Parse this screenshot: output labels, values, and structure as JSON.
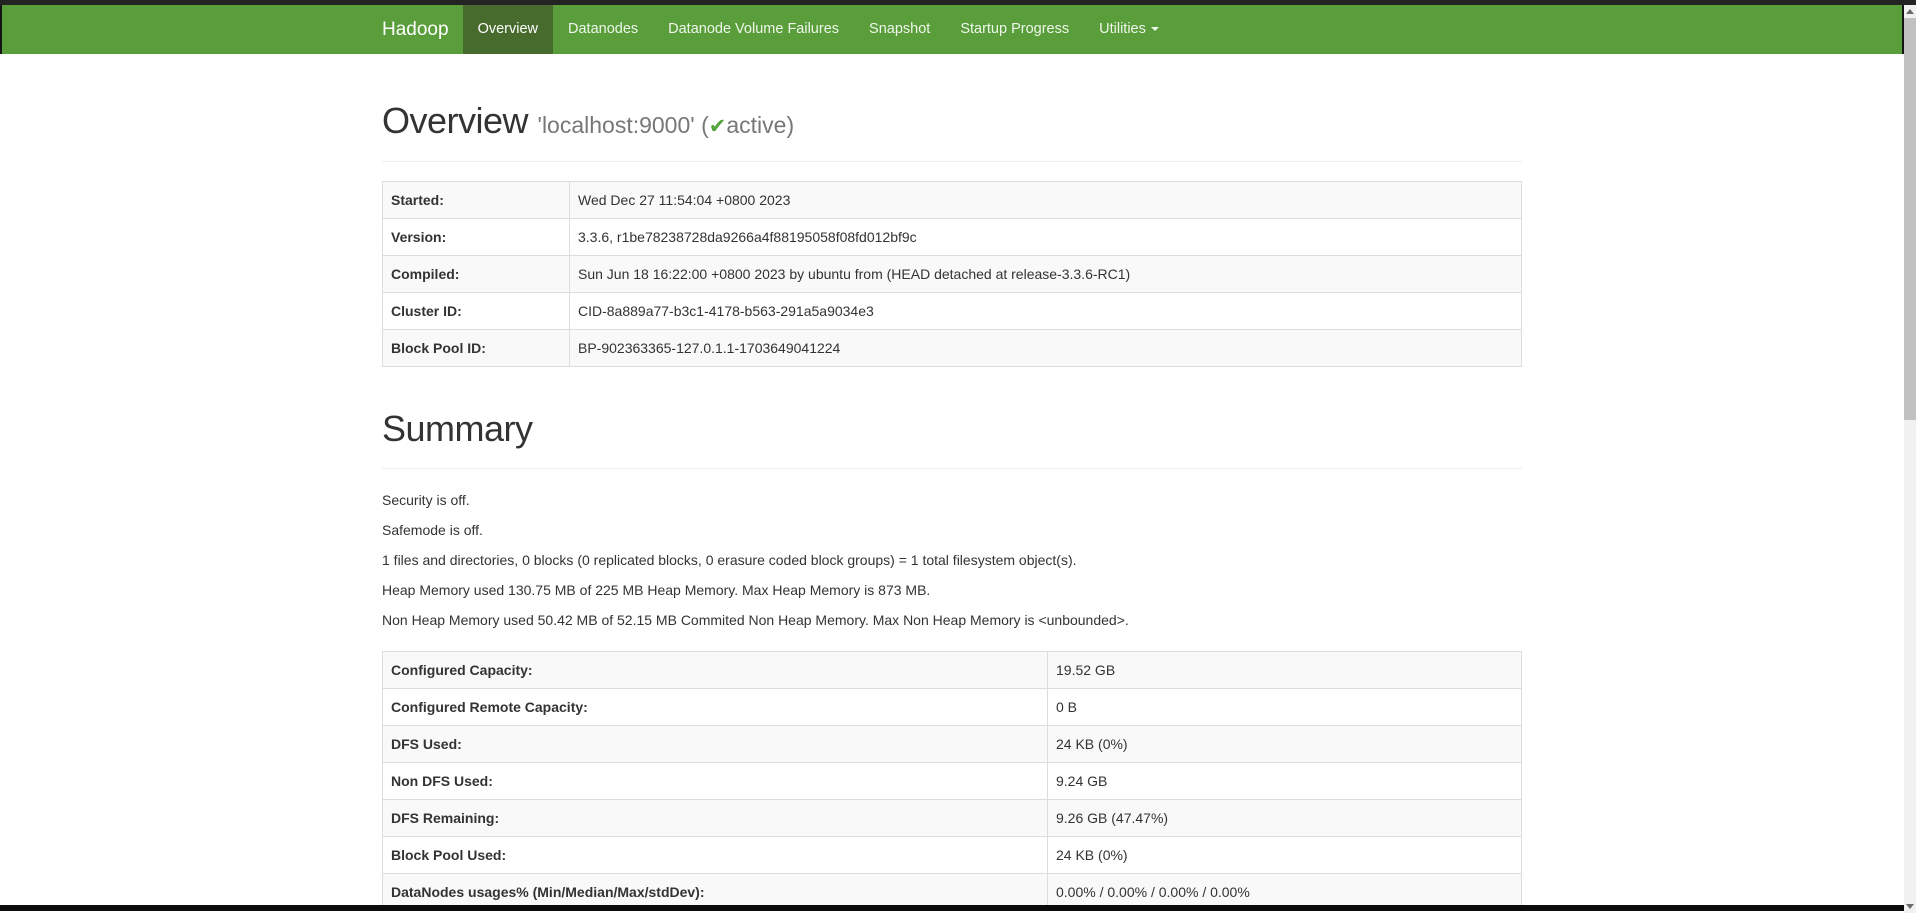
{
  "navbar": {
    "brand": "Hadoop",
    "items": [
      {
        "label": "Overview"
      },
      {
        "label": "Datanodes"
      },
      {
        "label": "Datanode Volume Failures"
      },
      {
        "label": "Snapshot"
      },
      {
        "label": "Startup Progress"
      },
      {
        "label": "Utilities"
      }
    ]
  },
  "header": {
    "title": "Overview",
    "host": "'localhost:9000'",
    "open_paren": "(",
    "check_icon": "✔",
    "state": "active",
    "close_paren": ")"
  },
  "info_table": {
    "rows": [
      {
        "label": "Started:",
        "value": "Wed Dec 27 11:54:04 +0800 2023"
      },
      {
        "label": "Version:",
        "value": "3.3.6, r1be78238728da9266a4f88195058f08fd012bf9c"
      },
      {
        "label": "Compiled:",
        "value": "Sun Jun 18 16:22:00 +0800 2023 by ubuntu from (HEAD detached at release-3.3.6-RC1)"
      },
      {
        "label": "Cluster ID:",
        "value": "CID-8a889a77-b3c1-4178-b563-291a5a9034e3"
      },
      {
        "label": "Block Pool ID:",
        "value": "BP-902363365-127.0.1.1-1703649041224"
      }
    ]
  },
  "summary": {
    "title": "Summary",
    "paragraphs": [
      "Security is off.",
      "Safemode is off.",
      "1 files and directories, 0 blocks (0 replicated blocks, 0 erasure coded block groups) = 1 total filesystem object(s).",
      "Heap Memory used 130.75 MB of 225 MB Heap Memory. Max Heap Memory is 873 MB.",
      "Non Heap Memory used 50.42 MB of 52.15 MB Commited Non Heap Memory. Max Non Heap Memory is <unbounded>."
    ]
  },
  "capacity_table": {
    "rows": [
      {
        "label": "Configured Capacity:",
        "value": "19.52 GB"
      },
      {
        "label": "Configured Remote Capacity:",
        "value": "0 B"
      },
      {
        "label": "DFS Used:",
        "value": "24 KB (0%)"
      },
      {
        "label": "Non DFS Used:",
        "value": "9.24 GB"
      },
      {
        "label": "DFS Remaining:",
        "value": "9.26 GB (47.47%)"
      },
      {
        "label": "Block Pool Used:",
        "value": "24 KB (0%)"
      },
      {
        "label": "DataNodes usages% (Min/Median/Max/stdDev):",
        "value": "0.00% / 0.00% / 0.00% / 0.00%"
      }
    ]
  },
  "colors": {
    "navbar_green": "#5a9e3b",
    "navbar_active_green": "#476a2d",
    "check_green": "#52a33a"
  }
}
